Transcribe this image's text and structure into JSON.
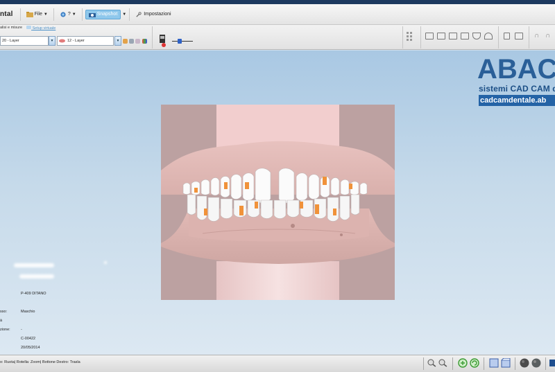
{
  "app": {
    "title": "ntal"
  },
  "menu": {
    "file": "File",
    "help": "?",
    "snapshot": "Snapshot",
    "settings": "Impostazioni"
  },
  "tabs": {
    "tab1": "alisi e misure",
    "tab2": "Setup virtuale"
  },
  "layers": {
    "left_value": "20 - Layer",
    "right_value": "12 - Layer"
  },
  "logo": {
    "brand": "ABAC",
    "subtitle": "sistemi CAD CAM d",
    "url": "cadcamdentale.ab"
  },
  "patient": {
    "name": "P-409  DITANO",
    "sex_label": "sso:",
    "sex_value": "Maschio",
    "row3_label": "à",
    "age_label": "zione:",
    "age_value": "-",
    "code": "C-00422",
    "date": "20/05/2014"
  },
  "status": {
    "hint": "o: Ruota| Rotella: Zoom| Bottone Destro: Trasla"
  },
  "colors": {
    "accent": "#8fc8ec",
    "brand": "#1c4f86",
    "attachment": "#f0923a"
  }
}
